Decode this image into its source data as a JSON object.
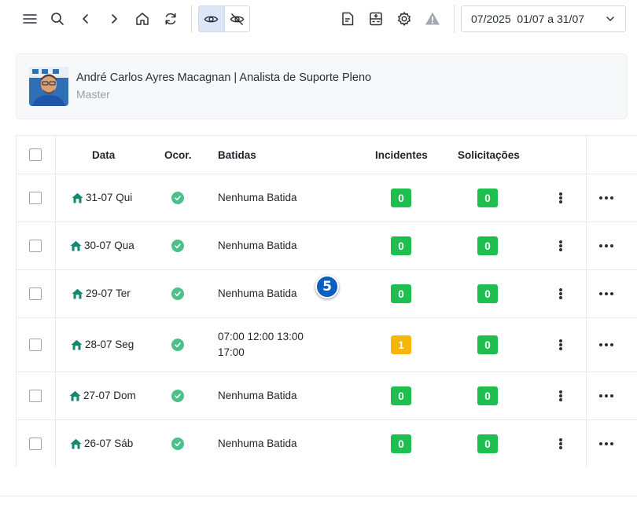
{
  "toolbar": {
    "icons": [
      "menu-icon",
      "search-icon",
      "back-icon",
      "forward-icon",
      "home-icon",
      "refresh-icon",
      "eye-icon",
      "eye-off-icon",
      "document-icon",
      "calculator-icon",
      "gear-icon",
      "warning-icon"
    ],
    "period_value": "07/2025  01/07 a 31/07"
  },
  "user": {
    "name": "André Carlos Ayres Macagnan | Analista de Suporte Pleno",
    "role": "Master"
  },
  "table": {
    "headers": {
      "date": "Data",
      "occurrence": "Ocor.",
      "punches": "Batidas",
      "incidents": "Incidentes",
      "requests": "Solicitações"
    },
    "rows": [
      {
        "date": "31-07 Qui",
        "punches": "Nenhuma Batida",
        "incidents": "0",
        "requests": "0",
        "incident_status": "green"
      },
      {
        "date": "30-07 Qua",
        "punches": "Nenhuma Batida",
        "incidents": "0",
        "requests": "0",
        "incident_status": "green"
      },
      {
        "date": "29-07 Ter",
        "punches": "Nenhuma Batida",
        "incidents": "0",
        "requests": "0",
        "incident_status": "green"
      },
      {
        "date": "28-07 Seg",
        "punches": "07:00 12:00 13:00 17:00",
        "incidents": "1",
        "requests": "0",
        "incident_status": "yellow"
      },
      {
        "date": "27-07 Dom",
        "punches": "Nenhuma Batida",
        "incidents": "0",
        "requests": "0",
        "incident_status": "green"
      },
      {
        "date": "26-07 Sáb",
        "punches": "Nenhuma Batida",
        "incidents": "0",
        "requests": "0",
        "incident_status": "green"
      }
    ]
  },
  "step_marker": "5",
  "colors": {
    "accent": "#0d5fbf",
    "success": "#1fbf4f",
    "warning": "#f4b707",
    "occurrence_ok": "#4cc08b",
    "home_icon": "#128a6e"
  }
}
